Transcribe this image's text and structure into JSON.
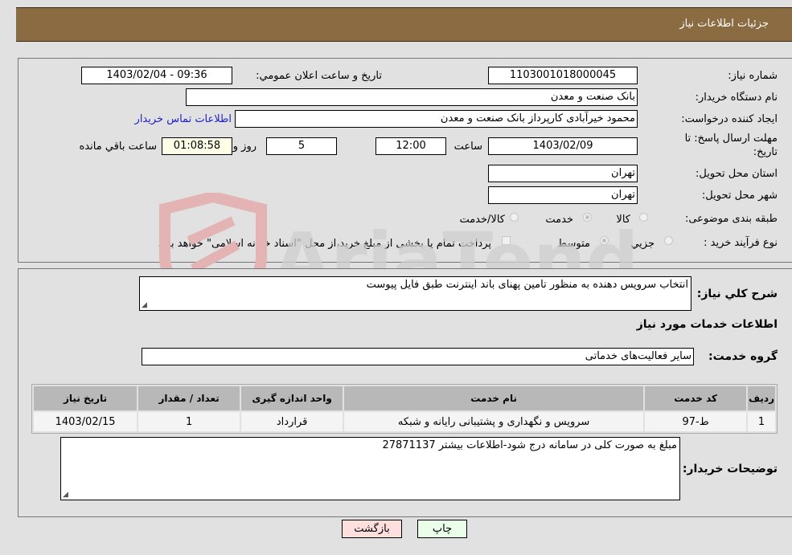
{
  "header": {
    "title": "جزئیات اطلاعات نیاز"
  },
  "fields": {
    "need_number_label": "شماره نیاز:",
    "need_number": "1103001018000045",
    "announce_label": "تاریخ و ساعت اعلان عمومي:",
    "announce_value": "1403/02/04 - 09:36",
    "buyer_org_label": "نام دستگاه خريدار:",
    "buyer_org": "بانک صنعت و معدن",
    "requester_label": "ايجاد کننده درخواست:",
    "requester": "محمود خیرآبادی کارپرداز بانک صنعت و معدن",
    "contact_link": "اطلاعات تماس خريدار",
    "deadline_label_1": "مهلت ارسال پاسخ: تا",
    "deadline_label_2": "تاريخ:",
    "deadline_date": "1403/02/09",
    "time_label": "ساعت",
    "deadline_time": "12:00",
    "days_value": "5",
    "days_label": "روز و",
    "remaining_time": "01:08:58",
    "remaining_label": "ساعت باقي مانده",
    "province_label": "استان محل تحويل:",
    "province": "تهران",
    "city_label": "شهر محل تحويل:",
    "city": "تهران",
    "category_label": "طبقه بندی موضوعی:",
    "category_options": [
      {
        "label": "کالا",
        "selected": false
      },
      {
        "label": "خدمت",
        "selected": true
      },
      {
        "label": "کالا/خدمت",
        "selected": false
      }
    ],
    "process_label": "نوع فرآيند خريد :",
    "process_options": [
      {
        "label": "جزيي",
        "selected": false
      },
      {
        "label": "متوسط",
        "selected": true
      }
    ],
    "treasury_note": "پرداخت تمام يا بخشی از مبلغ خريد،از محل \"اسناد خزانه اسلامی\" خواهد بود."
  },
  "details": {
    "description_label": "شرح کلي نياز:",
    "description": "انتخاب سرویس دهنده به منظور تامین پهنای باند اینترنت طبق فایل پیوست",
    "services_heading": "اطلاعات خدمات مورد نياز",
    "service_group_label": "گروه خدمت:",
    "service_group": "سایر فعالیت‌های خدماتی",
    "table": {
      "headers": [
        "رديف",
        "کد خدمت",
        "نام خدمت",
        "واحد اندازه گيری",
        "تعداد / مقدار",
        "تاريخ نياز"
      ],
      "rows": [
        [
          "1",
          "ط-97",
          "سرویس و نگهداری و پشتیبانی رایانه و شبکه",
          "قرارداد",
          "1",
          "1403/02/15"
        ]
      ]
    },
    "buyer_notes_label": "توضيحات خريدار:",
    "buyer_notes": "مبلغ به صورت کلی در سامانه درج شود-اطلاعات بیشتر 27871137"
  },
  "buttons": {
    "print": "چاپ",
    "back": "بازگشت"
  },
  "watermark": "AriaTender.neT"
}
